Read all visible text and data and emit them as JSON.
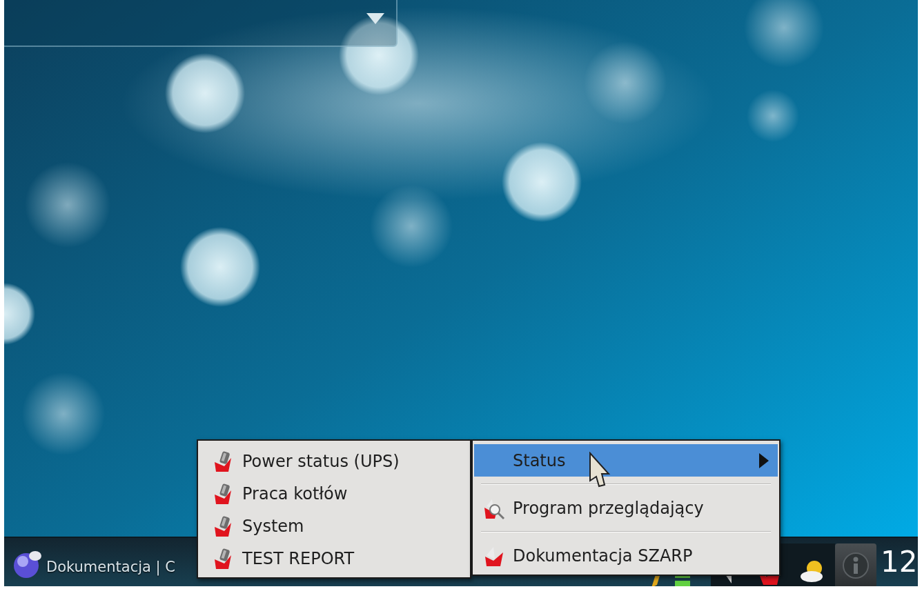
{
  "taskbar": {
    "launcher_text": "Dokumentacja | C",
    "clock": "12"
  },
  "menu": {
    "items": [
      {
        "kind": "submenu",
        "label": "Status",
        "selected": true
      },
      {
        "kind": "separator"
      },
      {
        "kind": "viewer",
        "label": "Program przeglądający",
        "selected": false
      },
      {
        "kind": "separator"
      },
      {
        "kind": "docs",
        "label": "Dokumentacja SZARP",
        "selected": false
      }
    ]
  },
  "submenu": {
    "items": [
      {
        "label": "Power status (UPS)",
        "selected": false
      },
      {
        "label": "Praca kotłów",
        "selected": false
      },
      {
        "label": "System",
        "selected": false
      },
      {
        "label": "TEST REPORT",
        "selected": false
      }
    ]
  }
}
